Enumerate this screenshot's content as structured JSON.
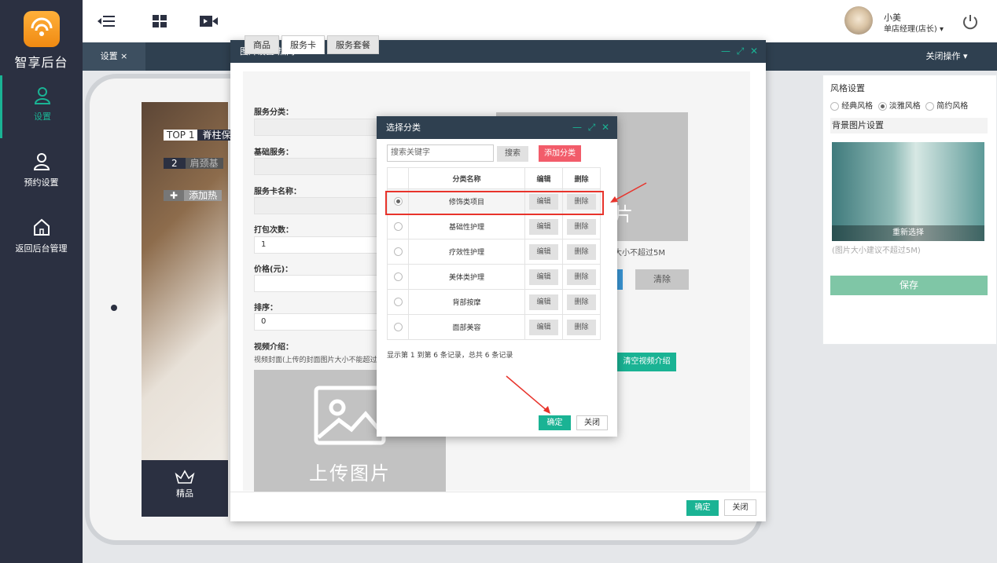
{
  "app": {
    "logo_text": "智享后台"
  },
  "sidebar": {
    "items": [
      {
        "label": "设置"
      },
      {
        "label": "预约设置"
      },
      {
        "label": "返回后台管理"
      }
    ]
  },
  "user": {
    "name": "小美",
    "role": "单店经理(店长) ▾"
  },
  "tabs": {
    "settings": "设置 ×",
    "close_ops": "关闭操作 ▾"
  },
  "phone": {
    "rows": [
      {
        "badge": "TOP 1",
        "text": "脊柱保"
      },
      {
        "badge": "2",
        "text": "肩颈基"
      },
      {
        "badge": "✚",
        "text": "添加热"
      }
    ],
    "bottom_label": "精品"
  },
  "right_panel": {
    "style_title": "风格设置",
    "styles": [
      "经典风格",
      "淡雅风格",
      "简约风格"
    ],
    "selected_style": "淡雅风格",
    "bg_title": "背景图片设置",
    "reselect": "重新选择",
    "hint": "(图片大小建议不超过5M)",
    "save": "保存"
  },
  "modal1": {
    "title": "图片设置-热门",
    "tabs": [
      "商品",
      "服务卡",
      "服务套餐"
    ],
    "active_tab": "服务卡",
    "fields": [
      {
        "label": "服务分类：",
        "value": ""
      },
      {
        "label": "基础服务：",
        "value": ""
      },
      {
        "label": "服务卡名称：",
        "value": ""
      },
      {
        "label": "打包次数：",
        "value": "1"
      },
      {
        "label": "价格(元)：",
        "value": ""
      },
      {
        "label": "排序：",
        "value": "0"
      }
    ],
    "video_label": "视频介绍：",
    "video_hint": "视频封面(上传的封面图片大小不能超过",
    "upload_text": "上传图片",
    "right_upload_text": "片",
    "right_hint": "大小不超过5M",
    "clear": "清除",
    "clear_video": "清空视频介绍",
    "ok": "确定",
    "close": "关闭"
  },
  "modal2": {
    "title": "选择分类",
    "search_placeholder": "搜索关键字",
    "search": "搜索",
    "add": "添加分类",
    "headers": [
      "",
      "分类名称",
      "编辑",
      "删除"
    ],
    "rows": [
      {
        "name": "修饰类项目",
        "selected": true
      },
      {
        "name": "基础性护理",
        "selected": false
      },
      {
        "name": "疗效性护理",
        "selected": false
      },
      {
        "name": "美体类护理",
        "selected": false
      },
      {
        "name": "背部按摩",
        "selected": false
      },
      {
        "name": "面部美容",
        "selected": false
      }
    ],
    "edit": "编辑",
    "delete": "删除",
    "pager": "显示第 1 到第 6 条记录，总共 6 条记录",
    "ok": "确定",
    "close": "关闭"
  },
  "colors": {
    "accent": "#1ab394",
    "sidebar": "#2b3041",
    "danger": "#f25c6a"
  }
}
